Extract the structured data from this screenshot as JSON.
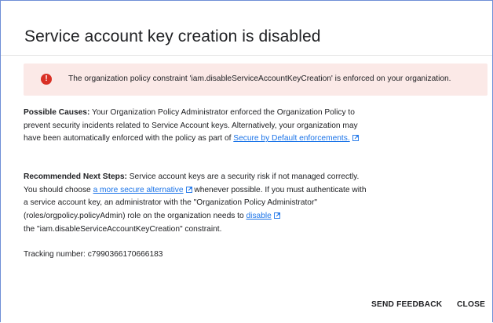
{
  "dialog": {
    "title": "Service account key creation is disabled"
  },
  "alert": {
    "icon": "error-icon",
    "color": "#d93025",
    "background": "#fbe9e7",
    "text": "The organization policy constraint 'iam.disableServiceAccountKeyCreation' is enforced on your organization."
  },
  "causes": {
    "label": "Possible Causes:",
    "text": " Your Organization Policy Administrator enforced the Organization Policy to prevent security incidents related to Service Account keys. Alternatively, your organization may have been automatically enforced with the policy as part of ",
    "link_text": "Secure by Default enforcements."
  },
  "next_steps": {
    "label": "Recommended Next Steps:",
    "text1": " Service account keys are a security risk if not managed correctly. You should choose ",
    "link1_text": "a more secure alternative",
    "text2": " whenever possible. If you must authenticate with a service account key, an administrator with the \"Organization Policy Administrator\" (roles/orgpolicy.policyAdmin) role on the organization needs to ",
    "link2_text": "disable",
    "text3": " the \"iam.disableServiceAccountKeyCreation\" constraint."
  },
  "tracking": {
    "text": "Tracking number: c7990366170666183"
  },
  "actions": {
    "send_feedback": "SEND FEEDBACK",
    "close": "CLOSE"
  },
  "colors": {
    "link": "#1a73e8",
    "frame_border": "#6f8fd6"
  }
}
